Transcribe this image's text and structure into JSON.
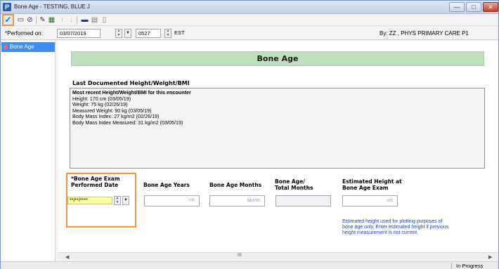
{
  "window": {
    "app_icon_letter": "P",
    "title": "Bone Age - TESTING, BLUE J",
    "min_glyph": "—",
    "max_glyph": "□",
    "close_glyph": "✕"
  },
  "toolbar": {
    "buttons": [
      {
        "name": "check-icon",
        "glyph": "✓"
      },
      {
        "name": "save-icon",
        "glyph": "▭"
      },
      {
        "name": "cancel-icon",
        "glyph": "⊘"
      },
      {
        "name": "wand-icon",
        "glyph": "✎"
      },
      {
        "name": "form-icon",
        "glyph": "▦"
      },
      {
        "name": "up-arrow-icon",
        "glyph": "↑"
      },
      {
        "name": "down-arrow-icon",
        "glyph": "↓"
      },
      {
        "name": "monitor-icon",
        "glyph": "▬"
      },
      {
        "name": "grid-icon",
        "glyph": "▤"
      },
      {
        "name": "print-icon",
        "glyph": "▯"
      }
    ]
  },
  "performed": {
    "label": "*Performed on:",
    "date": "03/07/2019",
    "time": "0527",
    "tz": "EST",
    "by": "By:  ZZ , PHYS PRIMARY CARE P1"
  },
  "sidebar": {
    "items": [
      {
        "label": "Bone Age"
      }
    ]
  },
  "form": {
    "banner": "Bone Age",
    "section_title": "Last Documented Height/Weight/BMI",
    "info_header": "Most recent Height/Weight/BMI for this encounter",
    "info_lines": [
      "Height: 170 cm (03/05/19)",
      "Weight: 75 kg (02/26/19)",
      "Measured Weight: 90 kg (03/05/19)",
      "Body Mass Index: 27 kg/m2 (02/26/19)",
      "Body Mass Index Measured: 31 kg/m2 (03/05/19)"
    ],
    "exam_date_label_1": "*Bone Age Exam",
    "exam_date_label_2": "Performed Date",
    "exam_date_value": "**/**/****",
    "years_label": "Bone Age Years",
    "years_unit": "YR",
    "months_label": "Bone Age Months",
    "months_unit": "Month",
    "total_label_1": "Bone Age/",
    "total_label_2": "Total Months",
    "height_label_1": "Estimated Height at",
    "height_label_2": "Bone Age Exam",
    "height_unit": "cm",
    "note": "Estimated height used for plotting purposes of bone age only.  Enter estimated height if previous height measurement is not current."
  },
  "scroll": {
    "left": "◀",
    "right": "▶",
    "grip": "III"
  },
  "status": {
    "text": "In Progress"
  },
  "colors": {
    "highlight": "#f0963a",
    "banner": "#bfe0bf",
    "note": "#1c3fd0",
    "date_field": "#ffffa0",
    "sidebar_selected": "#3c8ff0"
  }
}
